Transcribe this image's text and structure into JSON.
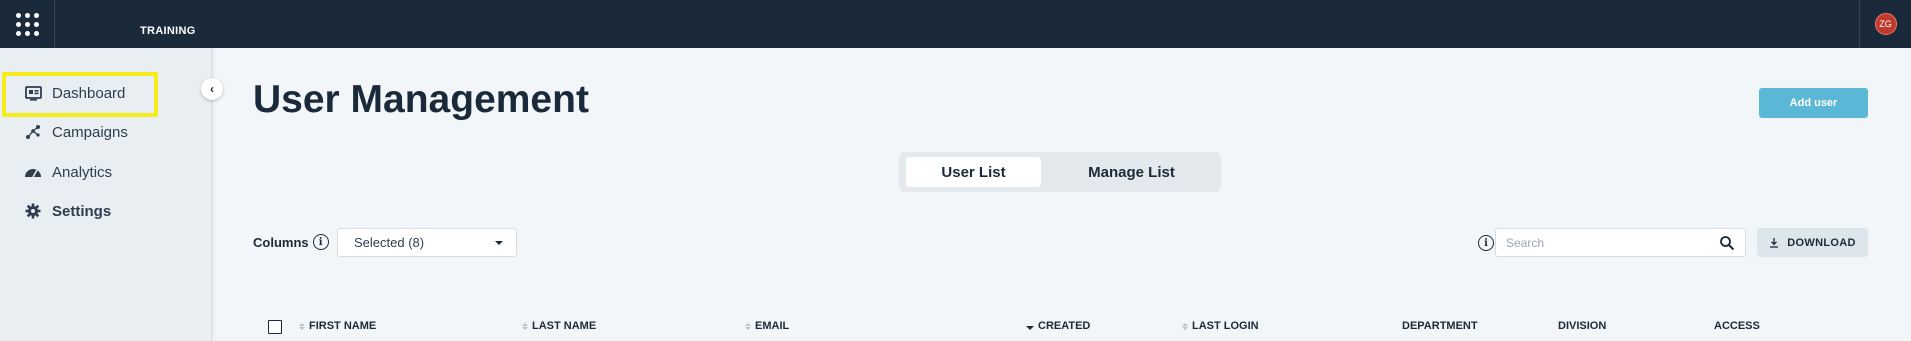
{
  "topbar": {
    "app_title": "TRAINING",
    "user_initials": "ZG"
  },
  "sidebar": {
    "items": [
      {
        "label": "Dashboard",
        "icon": "dashboard-icon"
      },
      {
        "label": "Campaigns",
        "icon": "campaigns-icon"
      },
      {
        "label": "Analytics",
        "icon": "analytics-icon"
      },
      {
        "label": "Settings",
        "icon": "gear-icon"
      }
    ],
    "highlighted": "Dashboard"
  },
  "main": {
    "title": "User Management",
    "add_user_label": "Add user",
    "tabs": [
      {
        "label": "User List",
        "active": true
      },
      {
        "label": "Manage List",
        "active": false
      }
    ],
    "columns_label": "Columns",
    "columns_selected": "Selected (8)",
    "search_placeholder": "Search",
    "download_label": "DOWNLOAD"
  },
  "table": {
    "headers": [
      "FIRST NAME",
      "LAST NAME",
      "EMAIL",
      "CREATED",
      "LAST LOGIN",
      "DEPARTMENT",
      "DIVISION",
      "ACCESS"
    ],
    "sorted_column": "CREATED",
    "sort_direction": "descending"
  },
  "colors": {
    "topbar": "#1b2a3a",
    "accent": "#5bb7d6",
    "highlight": "#f7ec1b",
    "avatar": "#c0392b"
  }
}
